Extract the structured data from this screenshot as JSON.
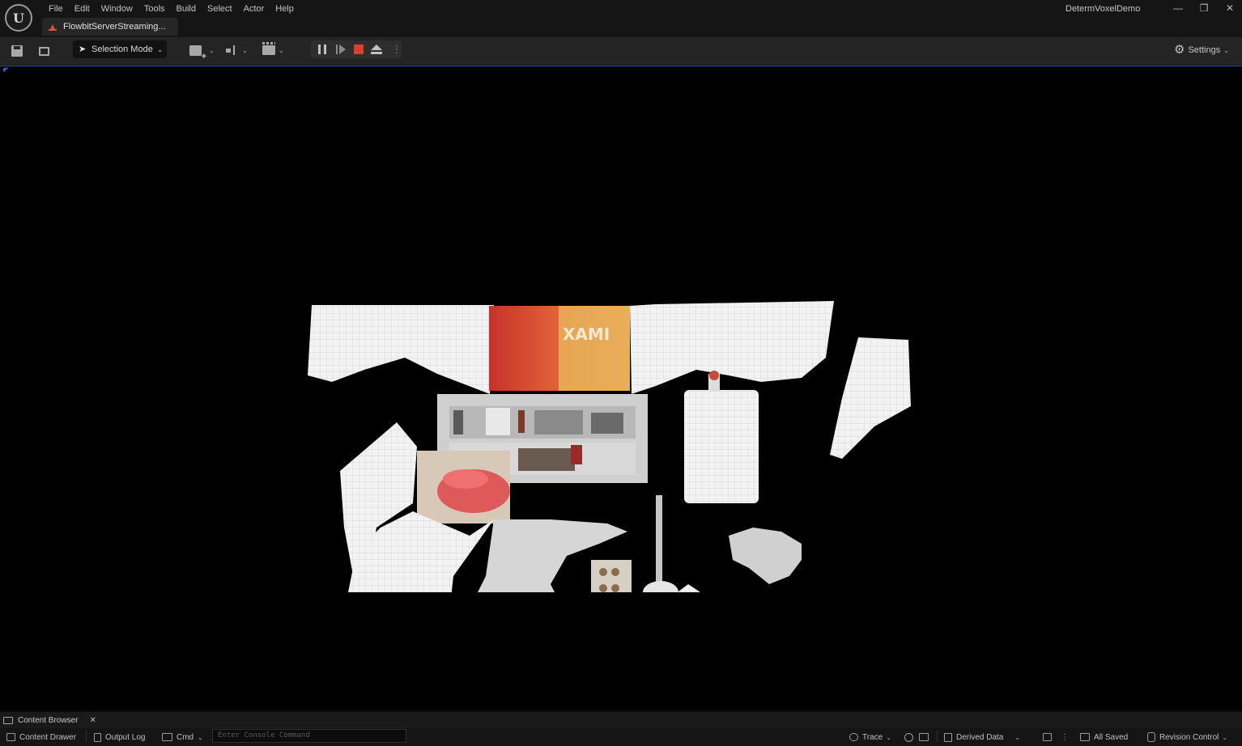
{
  "titlebar": {
    "menu": [
      "File",
      "Edit",
      "Window",
      "Tools",
      "Build",
      "Select",
      "Actor",
      "Help"
    ],
    "tab_label": "FlowbitServerStreaming...",
    "project_name": "DetermVoxelDemo",
    "minimize_glyph": "—",
    "restore_glyph": "❐",
    "close_glyph": "✕"
  },
  "toolbar": {
    "mode_label": "Selection Mode",
    "settings_label": "Settings",
    "more_glyph": "⋮"
  },
  "viewport": {
    "content": "voxel point-cloud render of a room"
  },
  "bottom": {
    "content_browser_tab": "Content Browser",
    "content_drawer": "Content Drawer",
    "output_log": "Output Log",
    "cmd": "Cmd",
    "console_placeholder": "Enter Console Command",
    "trace": "Trace",
    "derived_data": "Derived Data",
    "all_saved": "All Saved",
    "revision_control": "Revision Control",
    "close_glyph": "✕",
    "chevron_glyph": "⌄"
  },
  "colors": {
    "accent_blue": "#2a56c6",
    "stop_red": "#e23a2c",
    "panel": "#242424",
    "titlebar": "#151515"
  }
}
